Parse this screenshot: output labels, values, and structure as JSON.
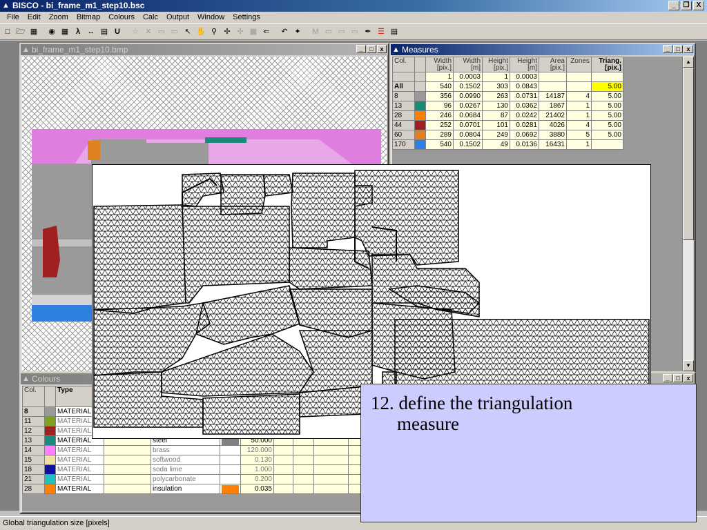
{
  "app": {
    "title": "BISCO - bi_frame_m1_step10.bsc",
    "window_buttons": [
      "_",
      "х",
      "X"
    ]
  },
  "menu": [
    "File",
    "Edit",
    "Zoom",
    "Bitmap",
    "Colours",
    "Calc",
    "Output",
    "Window",
    "Settings"
  ],
  "toolbar": [
    "new-icon",
    "open-icon",
    "save-icon",
    "camera-icon",
    "grid-icon",
    "lambda-icon",
    "arrows-icon",
    "hatch-icon",
    "u-icon",
    "tool-icon",
    "cross-icon",
    "tool-icon",
    "tool-icon",
    "pointer-icon",
    "hand-icon",
    "zoom-icon",
    "move-icon",
    "tool-icon",
    "tool-icon",
    "tool-icon",
    "wand-icon",
    "m-icon",
    "tool-icon",
    "tool-icon",
    "tool-icon",
    "tool-icon",
    "colours-icon",
    "report-icon"
  ],
  "bitmap_window": {
    "title": "bi_frame_m1_step10.bmp"
  },
  "measures_window": {
    "title": "Measures",
    "headers": [
      [
        "Col."
      ],
      [
        ""
      ],
      [
        "Width",
        "[pix.]"
      ],
      [
        "Width",
        "[m]"
      ],
      [
        "Height",
        "[pix.]"
      ],
      [
        "Height",
        "[m]"
      ],
      [
        "Area",
        "[pix.]"
      ],
      [
        "Zones"
      ],
      [
        "Triang.",
        "[pix.]"
      ]
    ],
    "rows": [
      {
        "col": "",
        "color": "",
        "w_pix": "1",
        "w_m": "0.0003",
        "h_pix": "1",
        "h_m": "0.0003",
        "area": "",
        "zones": "",
        "tri": ""
      },
      {
        "col": "All",
        "color": "",
        "w_pix": "540",
        "w_m": "0.1502",
        "h_pix": "303",
        "h_m": "0.0843",
        "area": "",
        "zones": "",
        "tri": "5.00"
      },
      {
        "col": "8",
        "color": "#9a9a9a",
        "w_pix": "356",
        "w_m": "0.0990",
        "h_pix": "263",
        "h_m": "0.0731",
        "area": "14187",
        "zones": "4",
        "tri": "5.00"
      },
      {
        "col": "13",
        "color": "#1a8a7a",
        "w_pix": "96",
        "w_m": "0.0267",
        "h_pix": "130",
        "h_m": "0.0362",
        "area": "1867",
        "zones": "1",
        "tri": "5.00"
      },
      {
        "col": "28",
        "color": "#ff8000",
        "w_pix": "246",
        "w_m": "0.0684",
        "h_pix": "87",
        "h_m": "0.0242",
        "area": "21402",
        "zones": "1",
        "tri": "5.00"
      },
      {
        "col": "44",
        "color": "#a02020",
        "w_pix": "252",
        "w_m": "0.0701",
        "h_pix": "101",
        "h_m": "0.0281",
        "area": "4026",
        "zones": "4",
        "tri": "5.00"
      },
      {
        "col": "60",
        "color": "#e08020",
        "w_pix": "289",
        "w_m": "0.0804",
        "h_pix": "249",
        "h_m": "0.0692",
        "area": "3880",
        "zones": "5",
        "tri": "5.00"
      },
      {
        "col": "170",
        "color": "#3080e0",
        "w_pix": "540",
        "w_m": "0.1502",
        "h_pix": "49",
        "h_m": "0.0136",
        "area": "16431",
        "zones": "1",
        "tri": ""
      }
    ]
  },
  "colours_window": {
    "title": "Colours",
    "headers": [
      "Col.",
      "",
      "Type"
    ],
    "rows": [
      {
        "col": "8",
        "color": "#9a9a9a",
        "type": "MATERIAL",
        "name": "",
        "sw": "",
        "value": ""
      },
      {
        "col": "11",
        "color": "#80a020",
        "type": "MATERIAL",
        "name": "",
        "sw": "",
        "value": ""
      },
      {
        "col": "12",
        "color": "#a02020",
        "type": "MATERIAL",
        "name": "",
        "sw": "",
        "value": ""
      },
      {
        "col": "13",
        "color": "#1a8a7a",
        "type": "MATERIAL",
        "name": "steel",
        "sw": "#808080",
        "value": "50.000"
      },
      {
        "col": "14",
        "color": "#ff80ff",
        "type": "MATERIAL",
        "name": "brass",
        "sw": "",
        "value": "120.000"
      },
      {
        "col": "15",
        "color": "#f0e0a0",
        "type": "MATERIAL",
        "name": "softwood",
        "sw": "",
        "value": "0.130"
      },
      {
        "col": "18",
        "color": "#1010a0",
        "type": "MATERIAL",
        "name": "soda lime",
        "sw": "",
        "value": "1.000"
      },
      {
        "col": "21",
        "color": "#20c0c0",
        "type": "MATERIAL",
        "name": "polycarbonate",
        "sw": "",
        "value": "0.200"
      },
      {
        "col": "28",
        "color": "#ff8000",
        "type": "MATERIAL",
        "name": "insulation",
        "sw": "#ff8000",
        "value": "0.035"
      }
    ]
  },
  "statusbar": "Global triangulation size [pixels]",
  "callout": {
    "line1": "12. define the triangulation",
    "line2": "measure"
  }
}
